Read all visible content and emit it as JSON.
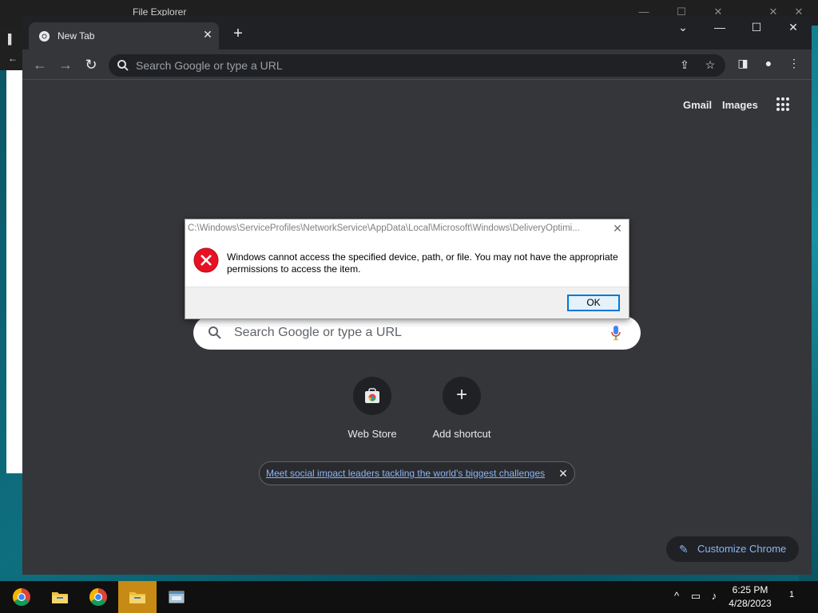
{
  "file_explorer": {
    "title": "File Explorer"
  },
  "chrome": {
    "tab": {
      "title": "New Tab"
    },
    "omnibox": {
      "placeholder": "Search Google or type a URL"
    },
    "header_links": {
      "gmail": "Gmail",
      "images": "Images"
    },
    "search": {
      "placeholder": "Search Google or type a URL"
    },
    "shortcuts": [
      {
        "label": "Web Store",
        "icon": "web-store-icon"
      },
      {
        "label": "Add shortcut",
        "icon": "plus-icon"
      }
    ],
    "promo": {
      "text": "Meet social impact leaders tackling the world's biggest challenges"
    },
    "customize": {
      "label": "Customize Chrome"
    }
  },
  "dialog": {
    "title": "C:\\Windows\\ServiceProfiles\\NetworkService\\AppData\\Local\\Microsoft\\Windows\\DeliveryOptimi...",
    "message": "Windows cannot access the specified device, path, or file. You may not have the appropriate permissions to access the item.",
    "ok_label": "OK"
  },
  "taskbar": {
    "apps": [
      {
        "name": "chrome",
        "icon": "chrome-icon",
        "active": false
      },
      {
        "name": "file-explorer",
        "icon": "folder-icon",
        "active": false
      },
      {
        "name": "chrome",
        "icon": "chrome-icon",
        "active": false
      },
      {
        "name": "file-explorer",
        "icon": "folder-icon",
        "active": true
      },
      {
        "name": "app",
        "icon": "app-window-icon",
        "active": false
      }
    ],
    "clock": {
      "time": "6:25 PM",
      "date": "4/28/2023"
    },
    "notification_count": "1"
  },
  "colors": {
    "chrome_bg": "#35363a",
    "link_blue": "#8ab4f8",
    "taskbar_active": "#c78a14",
    "error_red": "#e81123"
  }
}
